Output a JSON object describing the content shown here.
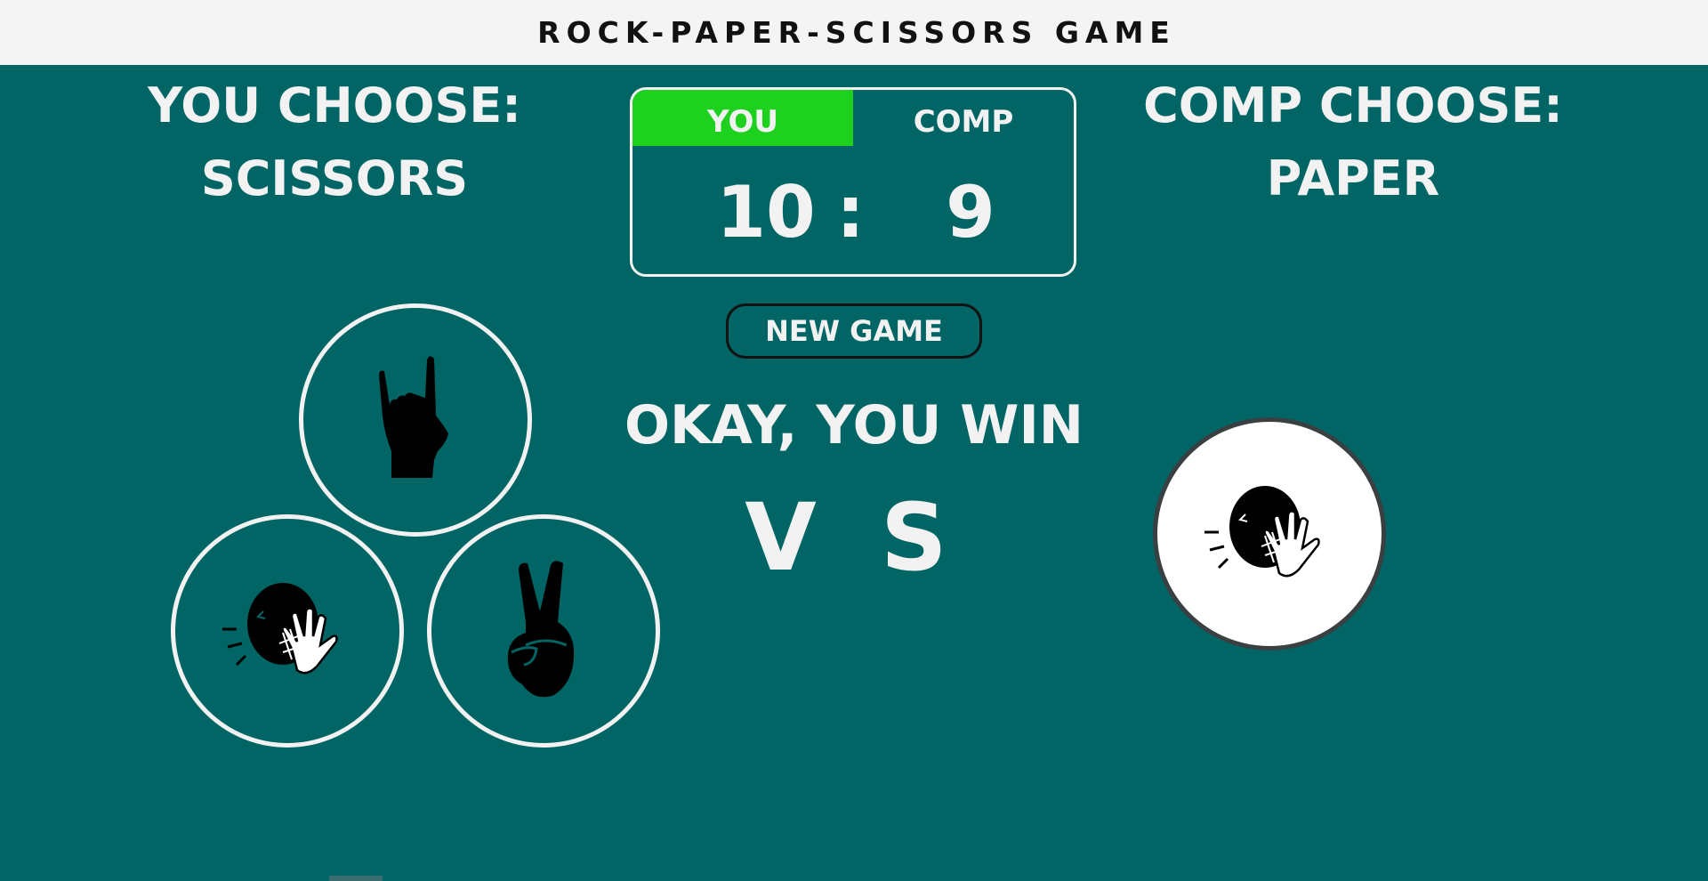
{
  "app": {
    "title": "ROCK-PAPER-SCISSORS GAME"
  },
  "player": {
    "heading_line1": "YOU CHOOSE:",
    "heading_line2": "SCISSORS",
    "choices": [
      {
        "id": "rock",
        "icon": "rock-hand-icon"
      },
      {
        "id": "paper",
        "icon": "paper-hand-icon"
      },
      {
        "id": "scissors",
        "icon": "scissors-hand-icon"
      }
    ]
  },
  "computer": {
    "heading_line1": "COMP CHOOSE:",
    "heading_line2": "PAPER",
    "choice_icon": "paper-hand-icon"
  },
  "scoreboard": {
    "you_label": "YOU",
    "comp_label": "COMP",
    "you_score": "10",
    "separator": ":",
    "comp_score": "9",
    "highlight_color": "#1fd11f"
  },
  "controls": {
    "new_game_label": "NEW GAME"
  },
  "result": {
    "message": "OKAY, YOU WIN",
    "vs_label": "V S"
  },
  "colors": {
    "background": "#026565",
    "topbar": "#f4f4f4",
    "text": "#f2f2f2"
  }
}
